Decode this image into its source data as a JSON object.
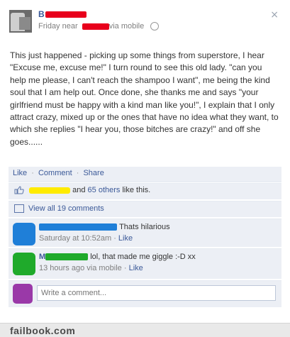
{
  "post": {
    "author_initial": "B",
    "meta_prefix": "Friday near",
    "meta_suffix": "via mobile",
    "close_glyph": "×",
    "body": "This just happened - picking up some things from superstore, I hear \"Excuse me, excuse me!\" I turn round to see this old lady. \"can you help me please, I can't reach the shampoo I want\", me being the kind soul that I am help out. Once done, she thanks me and says \"your girlfriend must be happy with a kind man like you!\", I explain that I only attract crazy, mixed up or the ones that have no idea what they want, to which she replies \"I hear you, those bitches are crazy!\" and off she goes......"
  },
  "actions": {
    "like": "Like",
    "comment": "Comment",
    "share": "Share",
    "separator": "·"
  },
  "likes": {
    "prefix_suffix": "and",
    "others_link": "65 others",
    "tail": "like this."
  },
  "view_all": "View all 19 comments",
  "comments": [
    {
      "text": "Thats hilarious",
      "time": "Saturday at 10:52am",
      "like": "Like",
      "avatar_color": "#1f7fd8",
      "redact_color": "#1f7fd8"
    },
    {
      "text": "lol, that made me giggle :-D xx",
      "time": "13 hours ago via mobile",
      "like": "Like",
      "avatar_color": "#1faa2b",
      "redact_color": "#1faa2b",
      "initial": "M"
    }
  ],
  "write": {
    "placeholder": "Write a comment..."
  },
  "footer": {
    "brand": "failbook.com"
  },
  "colors": {
    "link": "#3b5998",
    "redact_red": "#e8001c",
    "yellow": "#ffeb00",
    "purple": "#9a39a8"
  }
}
